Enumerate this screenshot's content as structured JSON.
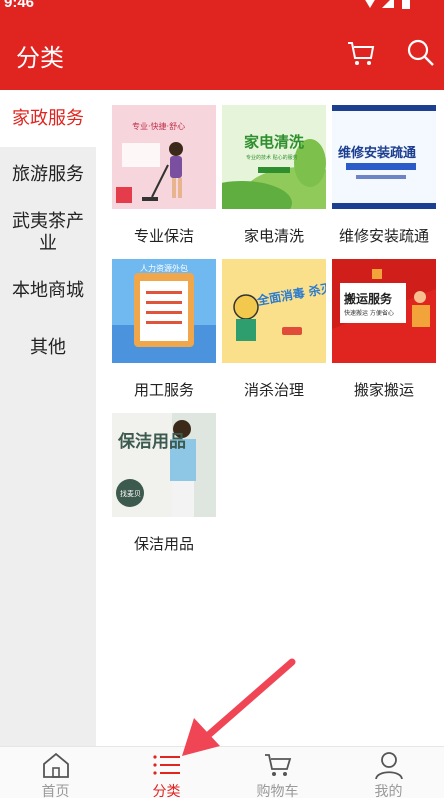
{
  "status": {
    "time": "9:46"
  },
  "header": {
    "title": "分类"
  },
  "sidebar": {
    "items": [
      {
        "label": "家政服务"
      },
      {
        "label": "旅游服务"
      },
      {
        "label": "武夷茶产业"
      },
      {
        "label": "本地商城"
      },
      {
        "label": "其他"
      }
    ]
  },
  "categories": [
    {
      "label": "专业保洁",
      "thumb_text": "专业·快捷·舒心"
    },
    {
      "label": "家电清洗",
      "thumb_text": "家电清洗",
      "thumb_sub": "专业的技术 贴心的服务"
    },
    {
      "label": "维修安装疏通",
      "thumb_text": "维修安装疏通"
    },
    {
      "label": "用工服务",
      "thumb_text": "人力资源外包"
    },
    {
      "label": "消杀治理",
      "thumb_text": "全面消毒 杀灭病菌"
    },
    {
      "label": "搬家搬运",
      "thumb_text": "搬运服务",
      "thumb_sub": "快速搬运 方便省心"
    },
    {
      "label": "保洁用品",
      "thumb_text": "保洁用品",
      "thumb_badge": "找麦贝"
    }
  ],
  "tabbar": {
    "items": [
      {
        "label": "首页"
      },
      {
        "label": "分类"
      },
      {
        "label": "购物车"
      },
      {
        "label": "我的"
      }
    ]
  },
  "colors": {
    "accent": "#e02520",
    "sidebar_bg": "#eeeeee",
    "inactive": "#999999"
  }
}
